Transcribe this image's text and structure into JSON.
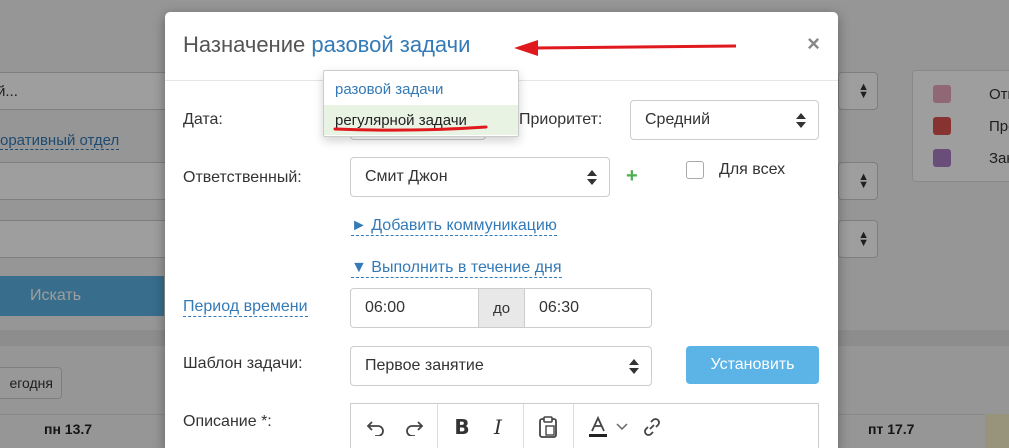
{
  "background": {
    "filter_select_1": "й...",
    "department_link": "оративный отдел",
    "search_button": "Искать",
    "legend": [
      {
        "label": "Отк",
        "color": "#e8a6bd"
      },
      {
        "label": "Про",
        "color": "#d9534f"
      },
      {
        "label": "Зак",
        "color": "#a97fc4"
      }
    ],
    "today_button": "егодня",
    "days": [
      "пн 13.7",
      "пт 17.7"
    ]
  },
  "modal": {
    "title_prefix": "Назначение",
    "title_link": "разовой задачи",
    "close_symbol": "×",
    "date_label": "Дата:",
    "priority_label": "Приоритет:",
    "priority_value": "Средний",
    "responsible_label": "Ответственный:",
    "responsible_value": "Смит Джон",
    "add_symbol": "+",
    "for_all_label": "Для всех",
    "add_communication": "► Добавить коммуникацию",
    "do_during_day": "▼ Выполнить в течение дня",
    "time_period_label": "Период времени",
    "time_from": "06:00",
    "time_to_label": "до",
    "time_to": "06:30",
    "template_label": "Шаблон задачи:",
    "template_value": "Первое занятие",
    "set_button": "Установить",
    "description_label": "Описание *:"
  },
  "dropdown": {
    "options": [
      "разовой задачи",
      "регулярной задачи"
    ],
    "highlighted": "регулярной задачи"
  },
  "annotation_color": "#e0191e",
  "accent_color": "#337ab7"
}
